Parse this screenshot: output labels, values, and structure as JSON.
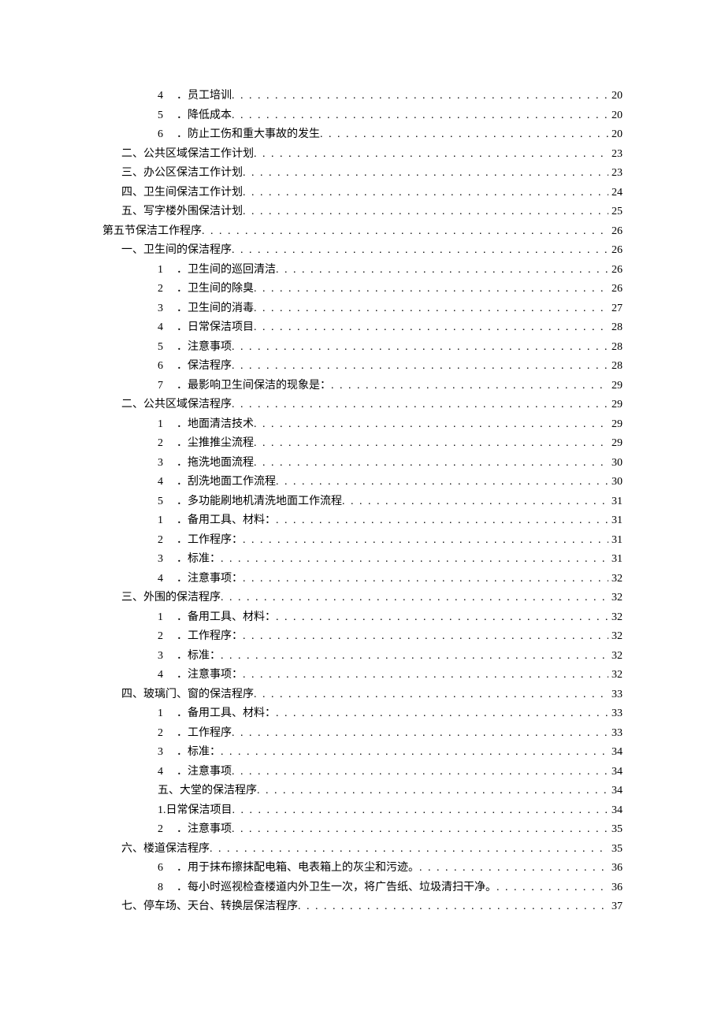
{
  "toc": [
    {
      "indent": "indent-2",
      "num": "4",
      "sep": "．",
      "title": "员工培训",
      "page": "20"
    },
    {
      "indent": "indent-2",
      "num": "5",
      "sep": "．",
      "title": "降低成本",
      "page": "20"
    },
    {
      "indent": "indent-2",
      "num": "6",
      "sep": "．",
      "title": "防止工伤和重大事故的发生",
      "page": "20"
    },
    {
      "indent": "indent-1",
      "num": "",
      "sep": "",
      "title": "二、公共区域保洁工作计划",
      "page": "23"
    },
    {
      "indent": "indent-1",
      "num": "",
      "sep": "",
      "title": "三、办公区保洁工作计划",
      "page": "23"
    },
    {
      "indent": "indent-1",
      "num": "",
      "sep": "",
      "title": "四、卫生间保洁工作计划",
      "page": "24"
    },
    {
      "indent": "indent-1",
      "num": "",
      "sep": "",
      "title": "五、写字楼外围保洁计划",
      "page": "25"
    },
    {
      "indent": "indent-0",
      "num": "",
      "sep": "",
      "title": "第五节保洁工作程序",
      "page": "26"
    },
    {
      "indent": "indent-1",
      "num": "",
      "sep": "",
      "title": "一、卫生间的保洁程序",
      "page": "26"
    },
    {
      "indent": "indent-2",
      "num": "1",
      "sep": "．",
      "title": "卫生间的巡回清洁",
      "page": "26"
    },
    {
      "indent": "indent-2",
      "num": "2",
      "sep": "．",
      "title": "卫生间的除臭",
      "page": "26"
    },
    {
      "indent": "indent-2",
      "num": "3",
      "sep": "．",
      "title": "卫生间的消毒",
      "page": "27"
    },
    {
      "indent": "indent-2",
      "num": "4",
      "sep": "．",
      "title": "日常保洁项目",
      "page": "28"
    },
    {
      "indent": "indent-2",
      "num": "5",
      "sep": "．",
      "title": "注意事项",
      "page": "28"
    },
    {
      "indent": "indent-2",
      "num": "6",
      "sep": "．",
      "title": "保洁程序",
      "page": "28"
    },
    {
      "indent": "indent-2",
      "num": "7",
      "sep": "．",
      "title": "最影响卫生间保洁的现象是：",
      "page": "29"
    },
    {
      "indent": "indent-1",
      "num": "",
      "sep": "",
      "title": "二、公共区域保洁程序",
      "page": "29"
    },
    {
      "indent": "indent-2",
      "num": "1",
      "sep": "．",
      "title": "地面清洁技术",
      "page": "29"
    },
    {
      "indent": "indent-2",
      "num": "2",
      "sep": "．",
      "title": "尘推推尘流程",
      "page": "29"
    },
    {
      "indent": "indent-2",
      "num": "3",
      "sep": "．",
      "title": "拖洗地面流程",
      "page": "30"
    },
    {
      "indent": "indent-2",
      "num": "4",
      "sep": "．",
      "title": "刮洗地面工作流程",
      "page": "30"
    },
    {
      "indent": "indent-2",
      "num": "5",
      "sep": "．",
      "title": "多功能刷地机清洗地面工作流程",
      "page": "31"
    },
    {
      "indent": "indent-2",
      "num": "1",
      "sep": "．",
      "title": "备用工具、材料：",
      "page": "31"
    },
    {
      "indent": "indent-2",
      "num": "2",
      "sep": "．",
      "title": "工作程序：",
      "page": "31"
    },
    {
      "indent": "indent-2",
      "num": "3",
      "sep": "．",
      "title": "标准：",
      "page": "31"
    },
    {
      "indent": "indent-2",
      "num": "4",
      "sep": "．",
      "title": "注意事项：",
      "page": "32"
    },
    {
      "indent": "indent-1",
      "num": "",
      "sep": "",
      "title": "三、外围的保洁程序",
      "page": "32"
    },
    {
      "indent": "indent-2",
      "num": "1",
      "sep": "．",
      "title": "备用工具、材料：",
      "page": "32"
    },
    {
      "indent": "indent-2",
      "num": "2",
      "sep": "．",
      "title": "工作程序：",
      "page": "32"
    },
    {
      "indent": "indent-2",
      "num": "3",
      "sep": "．",
      "title": "标准：",
      "page": "32"
    },
    {
      "indent": "indent-2",
      "num": "4",
      "sep": "．",
      "title": "注意事项：",
      "page": "32"
    },
    {
      "indent": "indent-1",
      "num": "",
      "sep": "",
      "title": "四、玻璃门、窗的保洁程序",
      "page": "33"
    },
    {
      "indent": "indent-2",
      "num": "1",
      "sep": "．",
      "title": "备用工具、材料：",
      "page": "33"
    },
    {
      "indent": "indent-2",
      "num": "2",
      "sep": "．",
      "title": "工作程序",
      "page": "33"
    },
    {
      "indent": "indent-2",
      "num": "3",
      "sep": "．",
      "title": "标准：",
      "page": "34"
    },
    {
      "indent": "indent-2",
      "num": "4",
      "sep": "．",
      "title": "注意事项",
      "page": "34"
    },
    {
      "indent": "indent-2b",
      "num": "",
      "sep": "",
      "title": "五、大堂的保洁程序",
      "page": "34"
    },
    {
      "indent": "indent-2b",
      "num": "",
      "sep": "",
      "title": "1.日常保洁项目",
      "page": "34"
    },
    {
      "indent": "indent-2",
      "num": "2",
      "sep": "．",
      "title": "注意事项",
      "page": "35"
    },
    {
      "indent": "indent-1",
      "num": "",
      "sep": "",
      "title": "六、楼道保洁程序",
      "page": "35"
    },
    {
      "indent": "indent-2",
      "num": "6",
      "sep": "．",
      "title": "用于抹布擦抹配电箱、电表箱上的灰尘和污迹。",
      "page": "36"
    },
    {
      "indent": "indent-2",
      "num": "8",
      "sep": "．",
      "title": "每小时巡视检查楼道内外卫生一次，将广告纸、垃圾清扫干净。",
      "page": "36"
    },
    {
      "indent": "indent-1",
      "num": "",
      "sep": "",
      "title": "七、停车场、天台、转换层保洁程序",
      "page": "37"
    }
  ]
}
